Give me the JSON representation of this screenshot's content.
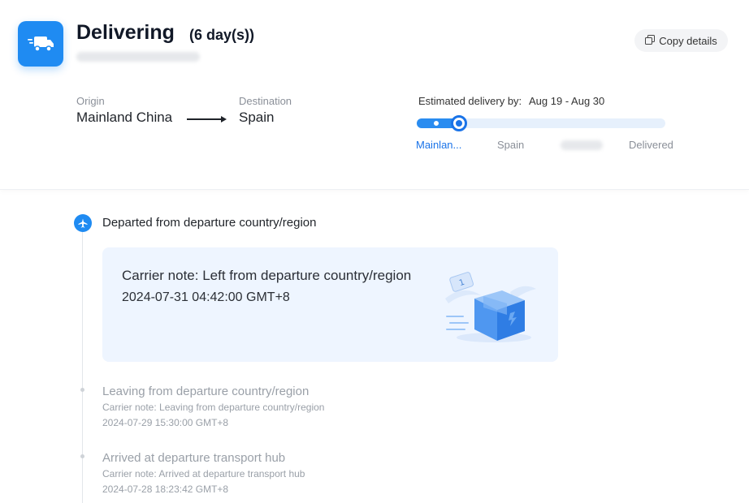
{
  "header": {
    "status": "Delivering",
    "days": "(6 day(s))",
    "tracking_number": "",
    "copy_label": "Copy details",
    "icon": "truck-icon"
  },
  "route": {
    "origin_label": "Origin",
    "origin_value": "Mainland China",
    "destination_label": "Destination",
    "destination_value": "Spain"
  },
  "estimate": {
    "label": "Estimated delivery by:",
    "value": "Aug 19 - Aug 30",
    "progress": 0.15,
    "stages": [
      "Mainlan...",
      "Spain",
      "",
      "Delivered"
    ],
    "active_stage": 0
  },
  "latest_event": {
    "icon": "airplane-icon",
    "title": "Departed from departure country/region",
    "note": "Carrier note: Left from departure country/region",
    "time": "2024-07-31 04:42:00 GMT+8"
  },
  "history": [
    {
      "title": "Leaving from departure country/region",
      "note": "Carrier note: Leaving from departure country/region",
      "time": "2024-07-29 15:30:00 GMT+8"
    },
    {
      "title": "Arrived at departure transport hub",
      "note": "Carrier note: Arrived at departure transport hub",
      "time": "2024-07-28 18:23:42 GMT+8"
    }
  ],
  "colors": {
    "accent": "#1f8bf2",
    "active_text": "#1a73e8",
    "muted_text": "#9aa0a8",
    "card_bg": "#eef5ff"
  }
}
